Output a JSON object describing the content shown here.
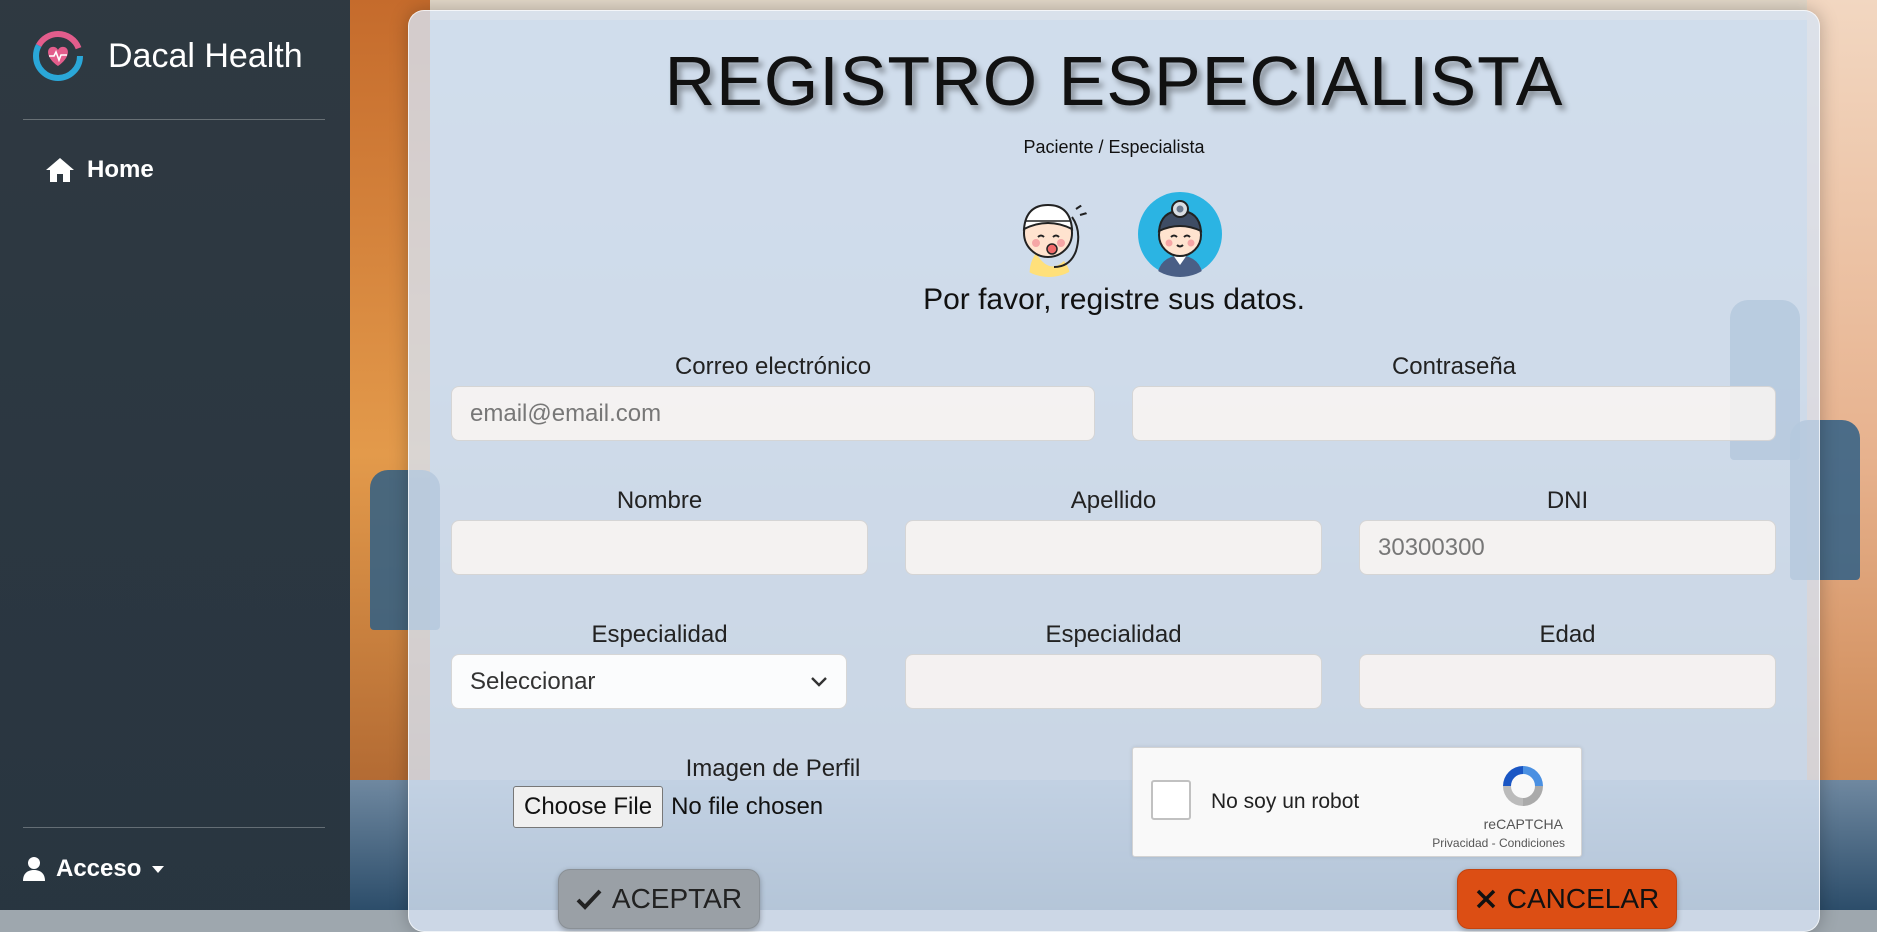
{
  "sidebar": {
    "brand": "Dacal Health",
    "home_label": "Home",
    "access_label": "Acceso"
  },
  "form": {
    "title": "REGISTRO ESPECIALISTA",
    "subtitle": "Paciente / Especialista",
    "intro": "Por favor, registre sus datos.",
    "email": {
      "label": "Correo electrónico",
      "placeholder": "email@email.com",
      "value": ""
    },
    "password": {
      "label": "Contraseña",
      "value": ""
    },
    "first_name": {
      "label": "Nombre",
      "value": ""
    },
    "last_name": {
      "label": "Apellido",
      "value": ""
    },
    "dni": {
      "label": "DNI",
      "placeholder": "30300300",
      "value": ""
    },
    "specialty_select": {
      "label": "Especialidad",
      "selected": "Seleccionar"
    },
    "specialty_text": {
      "label": "Especialidad",
      "value": ""
    },
    "age": {
      "label": "Edad",
      "value": ""
    },
    "profile_image": {
      "label": "Imagen de Perfil",
      "button": "Choose File",
      "status": "No file chosen"
    },
    "captcha": {
      "text": "No soy un robot",
      "brand": "reCAPTCHA",
      "links": "Privacidad - Condiciones"
    },
    "accept_label": "ACEPTAR",
    "cancel_label": "CANCELAR"
  },
  "colors": {
    "sidebar_bg": "#202529",
    "card_bg": "#d7e4f4",
    "cancel_button": "#dc4e14",
    "accept_button": "#9aa0a6",
    "logo_heart": "#e35d8c",
    "logo_ring": "#2aa7d8"
  },
  "icons": {
    "home": "home-icon",
    "user": "user-icon",
    "caret": "caret-down-icon",
    "check": "check-icon",
    "times": "times-icon",
    "chevron": "chevron-down-icon"
  }
}
